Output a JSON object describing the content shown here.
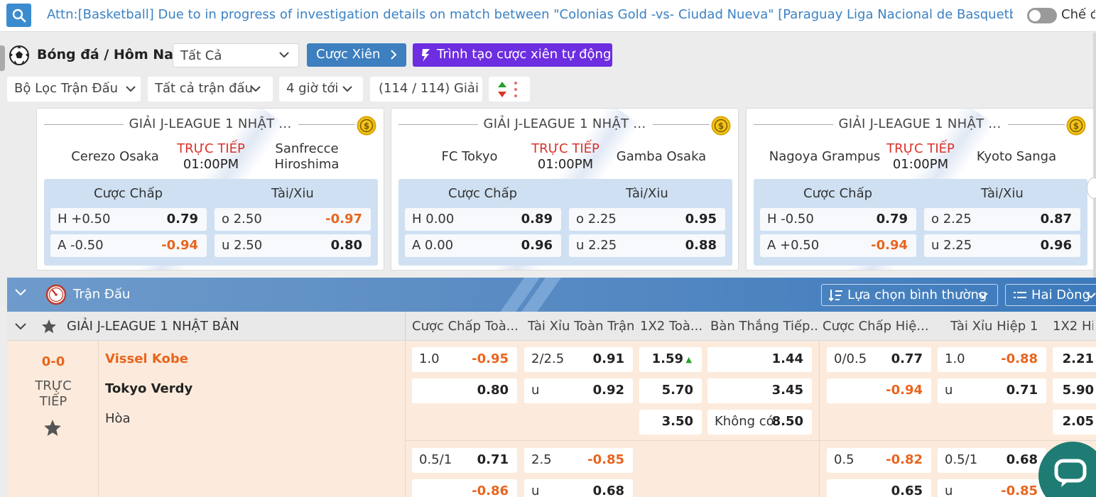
{
  "topbar": {
    "announcement": "Attn:[Basketball] Due to in progress of investigation details on match between \"Colonias Gold -vs- Ciudad Nueva\" [Paraguay Liga Nacional de Basquetbol -",
    "mode_label": "Chế độ"
  },
  "header": {
    "sport_title": "Bóng đá / Hôm Nay",
    "sport_select": "Tất Cả",
    "parlay_label": "Cược Xiên",
    "auto_parlay_label": "Trình tạo cược xiên tự động"
  },
  "filters": {
    "match_filter": "Bộ Lọc Trận Đấu",
    "all_matches": "Tất cả trận đấu",
    "time_range": "4 giờ tới",
    "league_count": "(114 / 114) Giải"
  },
  "cards": [
    {
      "league": "GIẢI J-LEAGUE 1 NHẬT ...",
      "home": "Cerezo Osaka",
      "away": "Sanfrecce Hiroshima",
      "status": "TRỰC TIẾP",
      "time": "01:00PM",
      "hdp_label": "Cược Chấp",
      "ou_label": "Tài/Xiu",
      "hdp": [
        {
          "label": "H +0.50",
          "odds": "0.79"
        },
        {
          "label": "A -0.50",
          "odds": "-0.94"
        }
      ],
      "ou": [
        {
          "label": "o 2.50",
          "odds": "-0.97"
        },
        {
          "label": "u 2.50",
          "odds": "0.80"
        }
      ]
    },
    {
      "league": "GIẢI J-LEAGUE 1 NHẬT ...",
      "home": "FC Tokyo",
      "away": "Gamba Osaka",
      "status": "TRỰC TIẾP",
      "time": "01:00PM",
      "hdp_label": "Cược Chấp",
      "ou_label": "Tài/Xiu",
      "hdp": [
        {
          "label": "H 0.00",
          "odds": "0.89"
        },
        {
          "label": "A 0.00",
          "odds": "0.96"
        }
      ],
      "ou": [
        {
          "label": "o 2.25",
          "odds": "0.95"
        },
        {
          "label": "u 2.25",
          "odds": "0.88"
        }
      ]
    },
    {
      "league": "GIẢI J-LEAGUE 1 NHẬT ...",
      "home": "Nagoya Grampus",
      "away": "Kyoto Sanga",
      "status": "TRỰC TIẾP",
      "time": "01:00PM",
      "hdp_label": "Cược Chấp",
      "ou_label": "Tài/Xiu",
      "hdp": [
        {
          "label": "H -0.50",
          "odds": "0.79"
        },
        {
          "label": "A +0.50",
          "odds": "-0.94"
        }
      ],
      "ou": [
        {
          "label": "o 2.25",
          "odds": "0.87"
        },
        {
          "label": "u 2.25",
          "odds": "0.96"
        }
      ]
    }
  ],
  "matchbar": {
    "title": "Trận Đấu",
    "view_select": "Lựa chọn bình thường",
    "line_select": "Hai Dòng"
  },
  "league_row": {
    "name": "GIẢI J-LEAGUE 1 NHẬT BẢN",
    "columns": [
      "Cược Chấp Toà...",
      "Tài Xỉu Toàn Trận",
      "1X2 Toà...",
      "Bàn Thắng Tiếp...",
      "Cược Chấp Hiệ...",
      "Tài Xỉu Hiệp 1",
      "1X2 Hi"
    ]
  },
  "match": {
    "score": "0-0",
    "status": "TRỰC TIẾP",
    "home": "Vissel Kobe",
    "away": "Tokyo Verdy",
    "draw": "Hòa",
    "rows": {
      "hdp_ft": [
        {
          "line": "1.0",
          "odds": "-0.95"
        },
        {
          "line": "",
          "odds": "0.80"
        },
        {
          "line": "0.5/1",
          "odds": "0.71"
        },
        {
          "line": "",
          "odds": "-0.86"
        }
      ],
      "ou_ft": [
        {
          "line": "2/2.5",
          "odds": "0.91"
        },
        {
          "line": "u",
          "odds": "0.92"
        },
        {
          "line": "2.5",
          "odds": "-0.85"
        },
        {
          "line": "u",
          "odds": "0.68"
        }
      ],
      "x12_ft": [
        "1.59",
        "5.70",
        "3.50"
      ],
      "next_goal": [
        {
          "line": "",
          "odds": "1.44"
        },
        {
          "line": "",
          "odds": "3.45"
        },
        {
          "line": "Không có",
          "odds": "8.50"
        }
      ],
      "hdp_h1": [
        {
          "line": "0/0.5",
          "odds": "0.77"
        },
        {
          "line": "",
          "odds": "-0.94"
        },
        {
          "line": "0.5",
          "odds": "-0.82"
        },
        {
          "line": "",
          "odds": "0.65"
        }
      ],
      "ou_h1": [
        {
          "line": "1.0",
          "odds": "-0.88"
        },
        {
          "line": "u",
          "odds": "0.71"
        },
        {
          "line": "0.5/1",
          "odds": "0.68"
        },
        {
          "line": "u",
          "odds": "-0.85"
        }
      ],
      "x12_h1": [
        "2.21",
        "5.90",
        "2.05"
      ]
    }
  },
  "colors": {
    "accent": "#3d7fbf",
    "purple": "#6d2de0",
    "orange": "#e8651e",
    "live_red": "#d9332b",
    "row_bg": "#fcebdc"
  }
}
